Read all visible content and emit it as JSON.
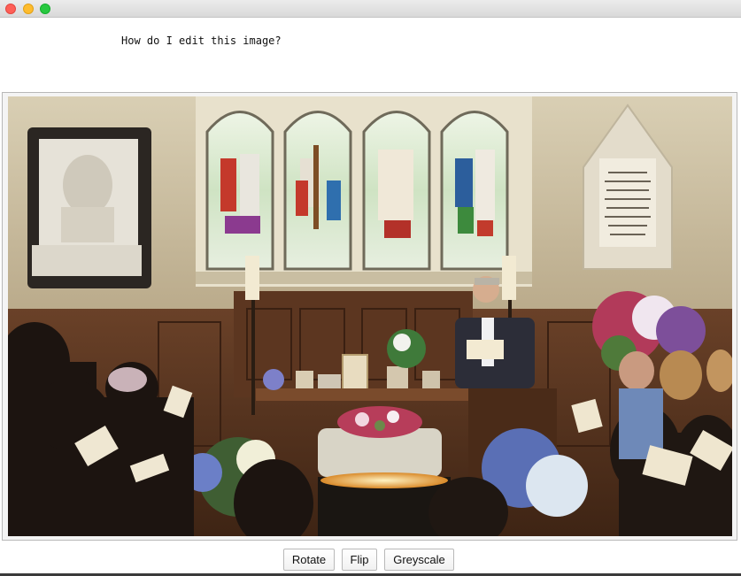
{
  "window": {
    "controls": [
      {
        "name": "close",
        "color": "#fe5f57"
      },
      {
        "name": "minimize",
        "color": "#febc2e"
      },
      {
        "name": "maximize",
        "color": "#28c840"
      }
    ]
  },
  "prompt": {
    "text": "How do I edit this image?"
  },
  "image": {
    "subject": "church-memorial-service-photo"
  },
  "buttons": {
    "rotate_label": "Rotate",
    "flip_label": "Flip",
    "greyscale_label": "Greyscale"
  }
}
